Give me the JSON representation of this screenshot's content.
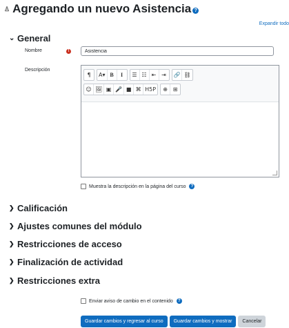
{
  "page": {
    "title": "Agregando un nuevo Asistencia",
    "expand_all": "Expandir todo"
  },
  "general": {
    "heading": "General",
    "name_label": "Nombre",
    "name_value": "Asistencia",
    "description_label": "Descripción",
    "show_description_label": "Muestra la descripción en la página del curso"
  },
  "editor": {
    "row1": [
      [
        "¶"
      ],
      [
        "A▾",
        "B",
        "I"
      ],
      [
        "☰",
        "☷",
        "⇤",
        "⇥"
      ],
      [
        "🔗",
        "⛓"
      ]
    ],
    "row2": [
      [
        "☺",
        "🖼",
        "▣",
        "🎤",
        "■",
        "⌘",
        "H5P"
      ],
      [
        "⊕",
        "⊞"
      ]
    ]
  },
  "sections": [
    {
      "label": "Calificación"
    },
    {
      "label": "Ajustes comunes del módulo"
    },
    {
      "label": "Restricciones de acceso"
    },
    {
      "label": "Finalización de actividad"
    },
    {
      "label": "Restricciones extra"
    }
  ],
  "notify_label": "Enviar aviso de cambio en el contenido",
  "buttons": {
    "save_return": "Guardar cambios y regresar al curso",
    "save_display": "Guardar cambios y mostrar",
    "cancel": "Cancelar"
  },
  "colors": {
    "primary": "#0f6cbf",
    "required": "#ca3120",
    "secondary": "#ced4da"
  }
}
